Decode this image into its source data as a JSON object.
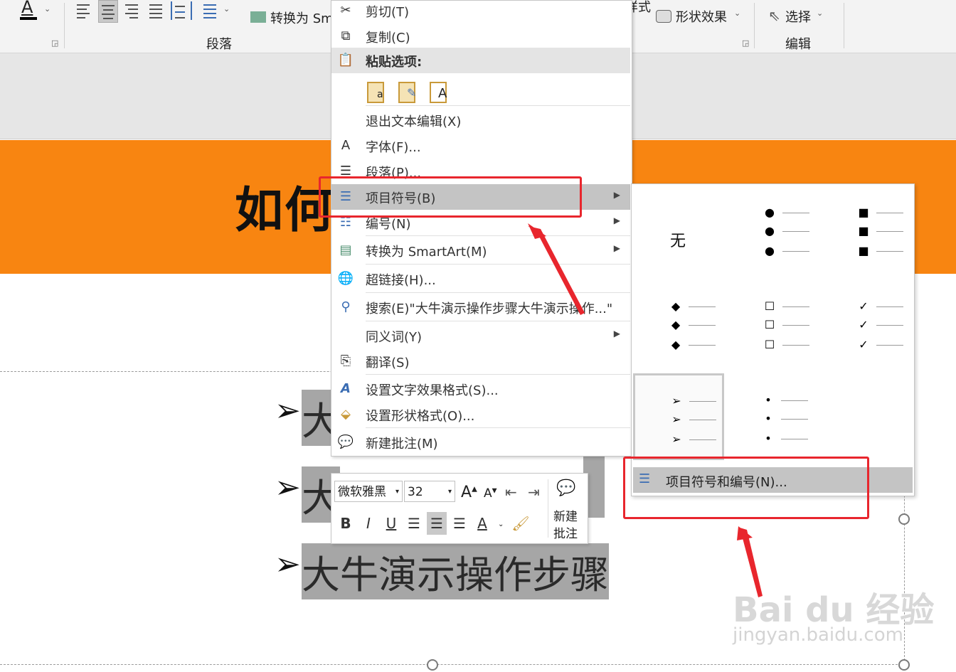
{
  "ribbon": {
    "convert_label": "转换为 Sm",
    "shape_effect": "形状效果",
    "style_partial": "样式",
    "select_label": "选择",
    "paragraph_group": "段落",
    "edit_group": "编辑"
  },
  "slide": {
    "title_partial": "如何",
    "bullets": [
      "大",
      "大",
      "大牛演示操作步骤"
    ],
    "bullet_symbol": "➢"
  },
  "context_menu": {
    "cut": "剪切(T)",
    "copy": "复制(C)",
    "paste_header": "粘贴选项:",
    "exit_edit": "退出文本编辑(X)",
    "font": "字体(F)...",
    "paragraph": "段落(P)...",
    "bullets": "项目符号(B)",
    "numbering": "编号(N)",
    "smartart": "转换为 SmartArt(M)",
    "hyperlink": "超链接(H)...",
    "search": "搜索(E)\"大牛演示操作步骤大牛演示操作...\"",
    "synonyms": "同义词(Y)",
    "translate": "翻译(S)",
    "text_effects": "设置文字效果格式(S)...",
    "shape_format": "设置形状格式(O)...",
    "new_comment": "新建批注(M)"
  },
  "bullet_submenu": {
    "none_label": "无",
    "options": [
      "none",
      "filled-circle",
      "filled-square",
      "diamond",
      "hollow-square",
      "checkmark",
      "arrowhead",
      "small-dot"
    ],
    "selected": "arrowhead",
    "footer": "项目符号和编号(N)..."
  },
  "mini_toolbar": {
    "font_name": "微软雅黑",
    "font_size": "32",
    "new_comment_line1": "新建",
    "new_comment_line2": "批注"
  },
  "watermark": {
    "logo": "Bai du 经验",
    "url": "jingyan.baidu.com"
  },
  "colors": {
    "accent_orange": "#f88511",
    "highlight_red": "#e8262d",
    "menu_highlight": "#c4c4c4"
  }
}
